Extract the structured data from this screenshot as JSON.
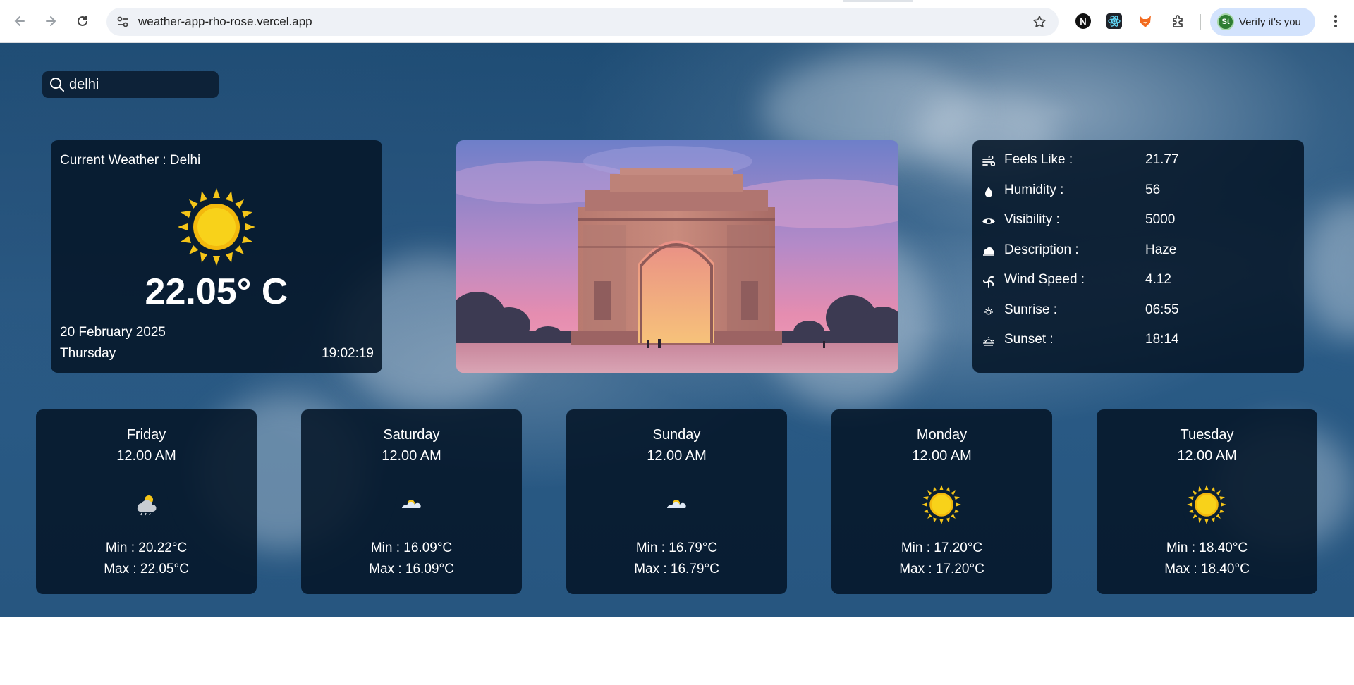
{
  "browser": {
    "url": "weather-app-rho-rose.vercel.app",
    "extensions": [
      "N"
    ],
    "profile_label": "Verify it's you",
    "profile_initials": "St"
  },
  "search": {
    "value": "delhi"
  },
  "current": {
    "title": "Current Weather : Delhi",
    "temp": "22.05° C",
    "date": "20 February 2025",
    "day": "Thursday",
    "time": "19:02:19",
    "icon": "sun-icon"
  },
  "details": [
    {
      "icon": "feels-like-icon",
      "label": "Feels Like :",
      "value": "21.77"
    },
    {
      "icon": "humidity-icon",
      "label": "Humidity :",
      "value": "56"
    },
    {
      "icon": "visibility-icon",
      "label": "Visibility :",
      "value": "5000"
    },
    {
      "icon": "description-icon",
      "label": "Description :",
      "value": "Haze"
    },
    {
      "icon": "wind-speed-icon",
      "label": "Wind Speed :",
      "value": "4.12"
    },
    {
      "icon": "sunrise-icon",
      "label": "Sunrise :",
      "value": "06:55"
    },
    {
      "icon": "sunset-icon",
      "label": "Sunset :",
      "value": "18:14"
    }
  ],
  "forecast": [
    {
      "day": "Friday",
      "time": "12.00 AM",
      "icon": "cloud-rain-icon",
      "min": "Min :  20.22°C",
      "max": "Max :  22.05°C"
    },
    {
      "day": "Saturday",
      "time": "12.00 AM",
      "icon": "cloud-sun-icon",
      "min": "Min :  16.09°C",
      "max": "Max :  16.09°C"
    },
    {
      "day": "Sunday",
      "time": "12.00 AM",
      "icon": "cloud-sun-icon",
      "min": "Min :  16.79°C",
      "max": "Max :  16.79°C"
    },
    {
      "day": "Monday",
      "time": "12.00 AM",
      "icon": "sun-icon",
      "min": "Min :  17.20°C",
      "max": "Max :  17.20°C"
    },
    {
      "day": "Tuesday",
      "time": "12.00 AM",
      "icon": "sun-icon",
      "min": "Min :  18.40°C",
      "max": "Max :  18.40°C"
    }
  ],
  "colors": {
    "card_bg": "#051628",
    "sun": "#f5c518",
    "profile_chip": "#d3e3fd"
  }
}
